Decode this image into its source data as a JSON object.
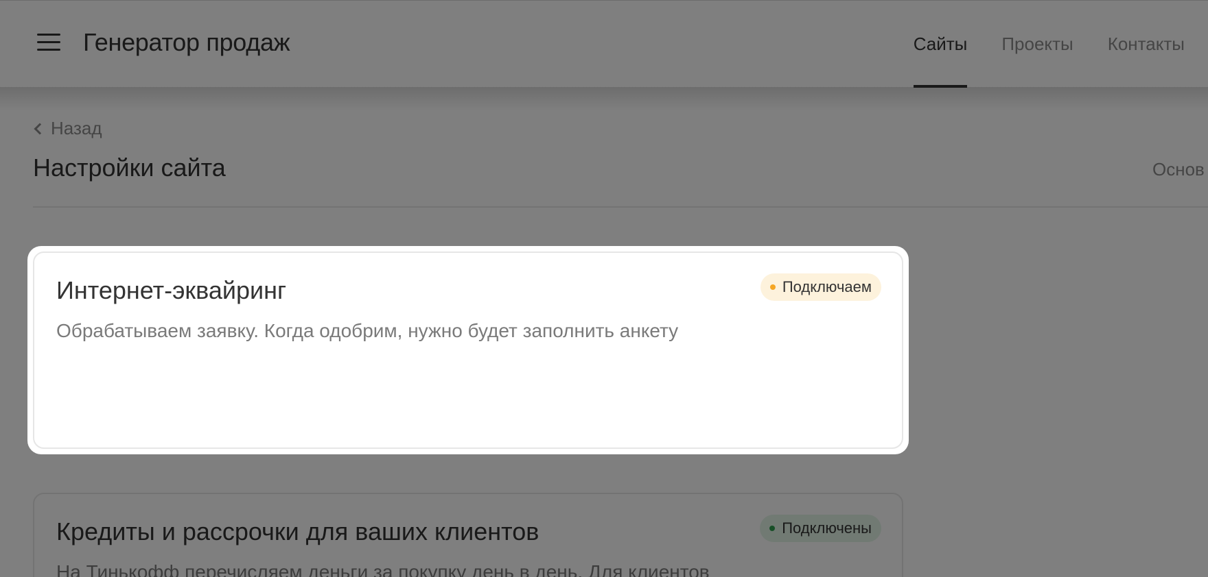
{
  "header": {
    "brand": "Генератор продаж",
    "nav": [
      {
        "label": "Сайты",
        "active": true
      },
      {
        "label": "Проекты",
        "active": false
      },
      {
        "label": "Контакты",
        "active": false
      }
    ]
  },
  "back_label": "Назад",
  "page_title": "Настройки сайта",
  "right_tab": "Основ",
  "cards": [
    {
      "title": "Интернет-эквайринг",
      "description": "Обрабатываем заявку. Когда одобрим, нужно будет заполнить анкету",
      "badge": {
        "label": "Подключаем",
        "color": "#f5a623",
        "bg": "#fdf2dc"
      }
    },
    {
      "title": "Кредиты и рассрочки для ваших клиентов",
      "description": "На Тинькофф перечисляем деньги за покупку день в день. Для клиентов",
      "badge": {
        "label": "Подключены",
        "color": "#2e9e4f",
        "bg": "#e3f4e7"
      }
    }
  ],
  "colors": {
    "overlay": "rgba(0,0,0,0.5)",
    "accent_text": "#333333",
    "muted_text": "#8a8a8a"
  }
}
